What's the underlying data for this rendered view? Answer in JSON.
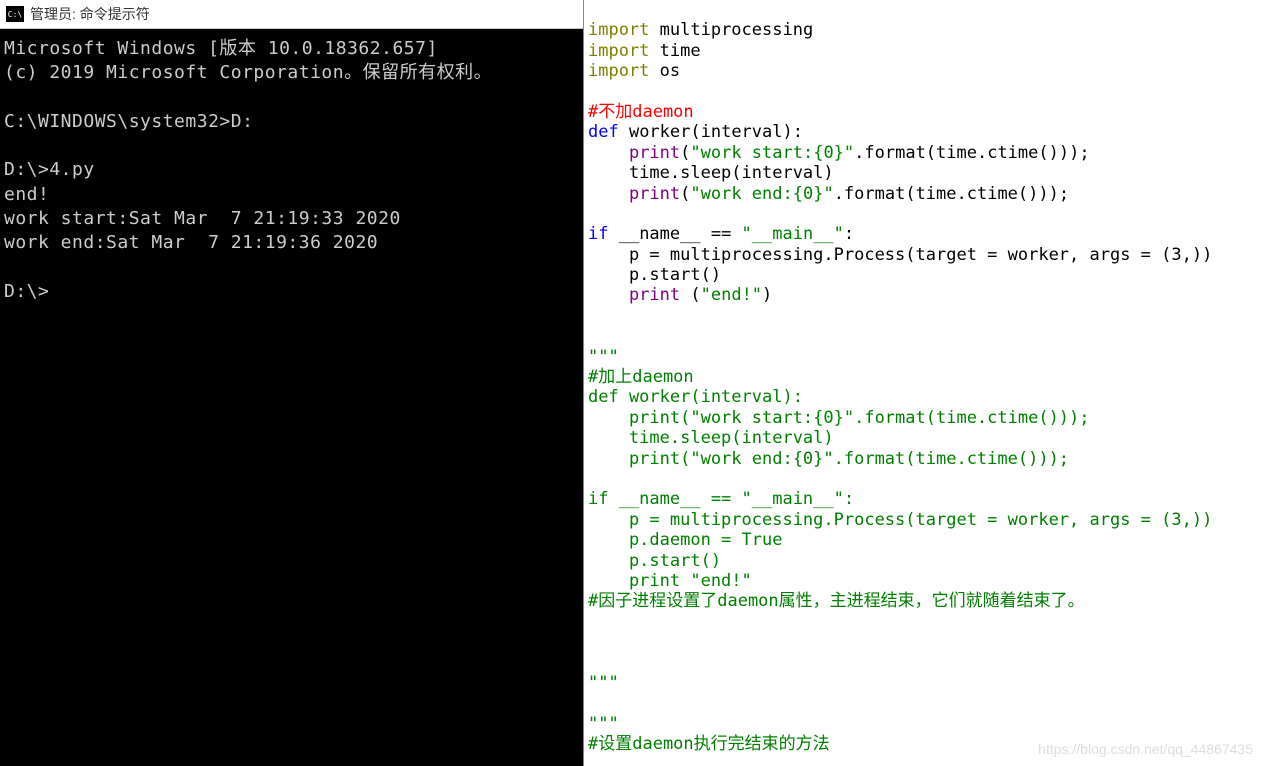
{
  "cmd": {
    "title": "管理员: 命令提示符",
    "icon_text": "C:\\",
    "lines": [
      "Microsoft Windows [版本 10.0.18362.657]",
      "(c) 2019 Microsoft Corporation。保留所有权利。",
      "",
      "C:\\WINDOWS\\system32>D:",
      "",
      "D:\\>4.py",
      "end!",
      "work start:Sat Mar  7 21:19:33 2020",
      "work end:Sat Mar  7 21:19:36 2020",
      "",
      "D:\\>"
    ]
  },
  "code": {
    "tokens": [
      [],
      [
        [
          "kw-import",
          "import"
        ],
        [
          "identifier",
          " multiprocessing"
        ]
      ],
      [
        [
          "kw-import",
          "import"
        ],
        [
          "identifier",
          " time"
        ]
      ],
      [
        [
          "kw-import",
          "import"
        ],
        [
          "identifier",
          " os"
        ]
      ],
      [],
      [
        [
          "comment-red",
          "#不加daemon"
        ]
      ],
      [
        [
          "kw-def",
          "def "
        ],
        [
          "funcname",
          "worker"
        ],
        [
          "identifier",
          "(interval):"
        ]
      ],
      [
        [
          "identifier",
          "    "
        ],
        [
          "kw-print",
          "print"
        ],
        [
          "identifier",
          "("
        ],
        [
          "string-lit",
          "\"work start:{0}\""
        ],
        [
          "identifier",
          ".format(time.ctime()));"
        ]
      ],
      [
        [
          "identifier",
          "    time.sleep(interval)"
        ]
      ],
      [
        [
          "identifier",
          "    "
        ],
        [
          "kw-print",
          "print"
        ],
        [
          "identifier",
          "("
        ],
        [
          "string-lit",
          "\"work end:{0}\""
        ],
        [
          "identifier",
          ".format(time.ctime()));"
        ]
      ],
      [],
      [
        [
          "kw-if",
          "if"
        ],
        [
          "identifier",
          " __name__ == "
        ],
        [
          "string-lit",
          "\"__main__\""
        ],
        [
          "identifier",
          ":"
        ]
      ],
      [
        [
          "identifier",
          "    p = multiprocessing.Process(target = worker, args = (3,))"
        ]
      ],
      [
        [
          "identifier",
          "    p.start()"
        ]
      ],
      [
        [
          "identifier",
          "    "
        ],
        [
          "kw-print",
          "print"
        ],
        [
          "identifier",
          " ("
        ],
        [
          "string-lit",
          "\"end!\""
        ],
        [
          "identifier",
          ")"
        ]
      ],
      [],
      [],
      [
        [
          "comment-green",
          "\"\"\""
        ]
      ],
      [
        [
          "comment-green",
          "#加上daemon"
        ]
      ],
      [
        [
          "comment-green",
          "def worker(interval):"
        ]
      ],
      [
        [
          "comment-green",
          "    print(\"work start:{0}\".format(time.ctime()));"
        ]
      ],
      [
        [
          "comment-green",
          "    time.sleep(interval)"
        ]
      ],
      [
        [
          "comment-green",
          "    print(\"work end:{0}\".format(time.ctime()));"
        ]
      ],
      [],
      [
        [
          "comment-green",
          "if __name__ == \"__main__\":"
        ]
      ],
      [
        [
          "comment-green",
          "    p = multiprocessing.Process(target = worker, args = (3,))"
        ]
      ],
      [
        [
          "comment-green",
          "    p.daemon = True"
        ]
      ],
      [
        [
          "comment-green",
          "    p.start()"
        ]
      ],
      [
        [
          "comment-green",
          "    print \"end!\""
        ]
      ],
      [
        [
          "comment-green",
          "#因子进程设置了daemon属性，主进程结束，它们就随着结束了。"
        ]
      ],
      [],
      [],
      [],
      [
        [
          "comment-green",
          "\"\"\""
        ]
      ],
      [],
      [
        [
          "comment-green",
          "\"\"\""
        ]
      ],
      [
        [
          "comment-green",
          "#设置daemon执行完结束的方法"
        ]
      ]
    ]
  },
  "watermark": "https://blog.csdn.net/qq_44867435"
}
